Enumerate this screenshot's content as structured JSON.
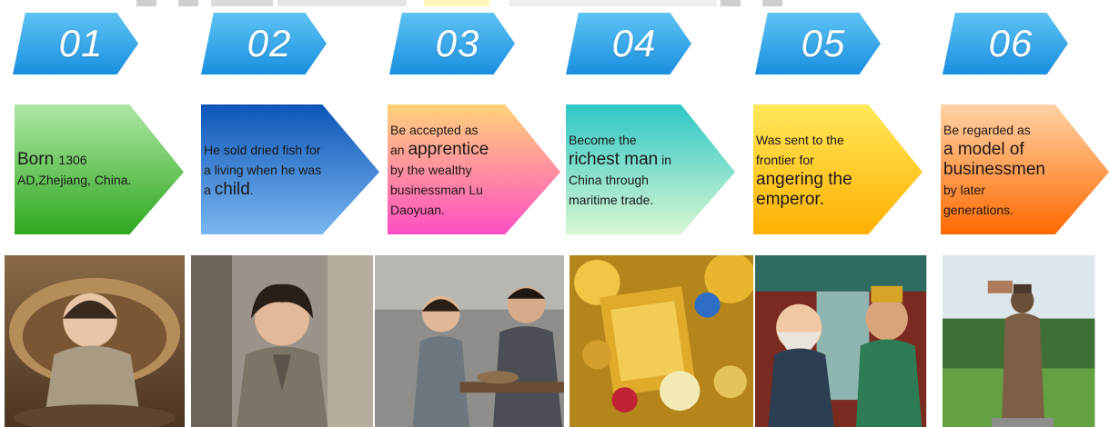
{
  "steps": [
    {
      "number": "01",
      "lines": [
        {
          "parts": [
            {
              "t": "Born ",
              "big": true
            },
            {
              "t": "1306",
              "big": false
            }
          ]
        },
        {
          "parts": [
            {
              "t": "AD,Zhejiang, China.",
              "big": false
            }
          ]
        }
      ],
      "colors": {
        "top": "#aee6a4",
        "bottom": "#2ea81e"
      }
    },
    {
      "number": "02",
      "lines": [
        {
          "parts": [
            {
              "t": "He sold dried fish for",
              "big": false
            }
          ]
        },
        {
          "parts": [
            {
              "t": "a living when he was",
              "big": false
            }
          ]
        },
        {
          "parts": [
            {
              "t": "a ",
              "big": false
            },
            {
              "t": "child",
              "big": true
            },
            {
              "t": ".",
              "big": false
            }
          ]
        }
      ],
      "colors": {
        "top": "#0d56b8",
        "bottom": "#7ab6f0"
      }
    },
    {
      "number": "03",
      "lines": [
        {
          "parts": [
            {
              "t": "Be accepted as",
              "big": false
            }
          ]
        },
        {
          "parts": [
            {
              "t": "an ",
              "big": false
            },
            {
              "t": "apprentice",
              "big": true
            }
          ]
        },
        {
          "parts": [
            {
              "t": "by the wealthy",
              "big": false
            }
          ]
        },
        {
          "parts": [
            {
              "t": "businessman Lu",
              "big": false
            }
          ]
        },
        {
          "parts": [
            {
              "t": "Daoyuan.",
              "big": false
            }
          ]
        }
      ],
      "colors": {
        "top": "#ffd27a",
        "bottom": "#ff4fc4"
      }
    },
    {
      "number": "04",
      "lines": [
        {
          "parts": [
            {
              "t": "Become the",
              "big": false
            }
          ]
        },
        {
          "parts": [
            {
              "t": "richest man",
              "big": true
            },
            {
              "t": " in",
              "big": false
            }
          ]
        },
        {
          "parts": [
            {
              "t": "China through",
              "big": false
            }
          ]
        },
        {
          "parts": [
            {
              "t": "maritime trade.",
              "big": false
            }
          ]
        }
      ],
      "colors": {
        "top": "#2ec7c7",
        "bottom": "#d9f7d2"
      }
    },
    {
      "number": "05",
      "lines": [
        {
          "parts": [
            {
              "t": "Was sent to the",
              "big": false
            }
          ]
        },
        {
          "parts": [
            {
              "t": "frontier",
              "big": false
            },
            {
              "t": " for",
              "big": false
            }
          ]
        },
        {
          "parts": [
            {
              "t": "angering the",
              "big": true
            }
          ]
        },
        {
          "parts": [
            {
              "t": "emperor.",
              "big": true
            }
          ]
        }
      ],
      "colors": {
        "top": "#ffe85a",
        "bottom": "#ffb000"
      }
    },
    {
      "number": "06",
      "lines": [
        {
          "parts": [
            {
              "t": "Be regarded as",
              "big": false
            }
          ]
        },
        {
          "parts": [
            {
              "t": "a model of",
              "big": true
            }
          ]
        },
        {
          "parts": [
            {
              "t": "businessmen",
              "big": true
            }
          ]
        },
        {
          "parts": [
            {
              "t": "by later",
              "big": false
            }
          ]
        },
        {
          "parts": [
            {
              "t": "generations.",
              "big": false
            }
          ]
        }
      ],
      "colors": {
        "top": "#ffd2a6",
        "bottom": "#ff6a00"
      }
    }
  ],
  "accent_blue_light": "#5ec3f3",
  "accent_blue_dark": "#1a8fe0",
  "photo_subjects": [
    "baby-photo",
    "boy-photo",
    "apprentice-photo",
    "treasure-photo",
    "emperor-photo",
    "statue-photo"
  ]
}
